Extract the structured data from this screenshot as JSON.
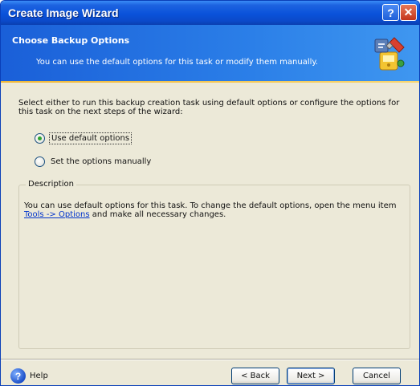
{
  "window": {
    "title": "Create Image Wizard",
    "help_glyph": "?",
    "close_glyph": "✕"
  },
  "header": {
    "title": "Choose Backup Options",
    "subtitle": "You can use the default options for this task or modify them manually."
  },
  "main": {
    "intro": "Select either to run this backup creation task using default options or configure the options for this task on the next steps of the wizard:",
    "options": [
      {
        "label": "Use default options",
        "selected": true
      },
      {
        "label": "Set the options manually",
        "selected": false
      }
    ],
    "description": {
      "legend": "Description",
      "text_before": "You can use default options for this task. To change the default options, open the menu item",
      "link": "Tools -> Options",
      "text_after": "and make all necessary changes."
    }
  },
  "footer": {
    "help_label": "Help",
    "help_glyph": "?",
    "back_label": "< Back",
    "next_label": "Next >",
    "cancel_label": "Cancel"
  },
  "colors": {
    "titlebar": "#0a52da",
    "header": "#2b7fe8",
    "accent_line": "#f0b838",
    "window_bg": "#ece9d8",
    "link": "#0033cc"
  }
}
